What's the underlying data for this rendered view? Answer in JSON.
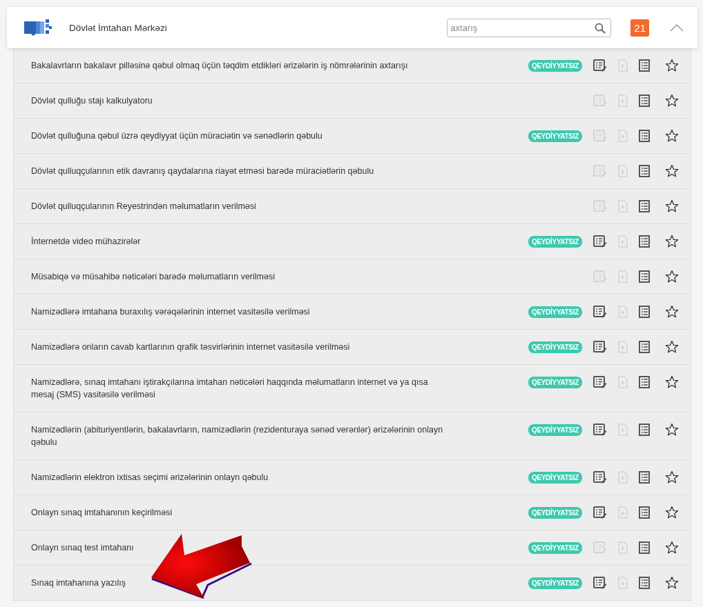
{
  "header": {
    "title": "Dövlət İmtahan Mərkəzi",
    "search": {
      "placeholder": "axtarış"
    },
    "count": "21",
    "expanded": true
  },
  "services": [
    {
      "title": "Bakalavrların bakalavr pilləsinə qəbul olmaq üçün təqdim etdikləri ərizələrin iş nömrələrinin axtarışı",
      "badge": "QEYDİYYATSIZ",
      "form_disabled": false,
      "video_disabled": true
    },
    {
      "title": "Dövlət qulluğu stajı kalkulyatoru",
      "form_disabled": true,
      "video_disabled": true
    },
    {
      "title": "Dövlət qulluğuna qəbul üzrə qeydiyyat üçün müraciətin və sənədlərin qəbulu",
      "badge": "QEYDİYYATSIZ",
      "form_disabled": true,
      "video_disabled": true
    },
    {
      "title": "Dövlət qulluqçularının etik davranış qaydalarına riayət etməsi barədə müraciətlərin qəbulu",
      "form_disabled": true,
      "video_disabled": true
    },
    {
      "title": "Dövlət qulluqçularının Reyestrindən məlumatların verilməsi",
      "form_disabled": true,
      "video_disabled": true
    },
    {
      "title": "İnternetdə video mühazirələr",
      "badge": "QEYDİYYATSIZ",
      "form_disabled": false,
      "video_disabled": true
    },
    {
      "title": "Müsabiqə və müsahibə nəticələri barədə məlumatların verilməsi",
      "form_disabled": true,
      "video_disabled": true
    },
    {
      "title": "Namizədlərə imtahana buraxılış vərəqələrinin internet vasitəsilə verilməsi",
      "badge": "QEYDİYYATSIZ",
      "form_disabled": false,
      "video_disabled": true
    },
    {
      "title": "Namizədlərə onların cavab kartlarının qrafik təsvirlərinin internet vasitəsilə verilməsi",
      "badge": "QEYDİYYATSIZ",
      "form_disabled": false,
      "video_disabled": true
    },
    {
      "title": "Namizədlərə, sınaq imtahanı iştirakçılarına imtahan nəticələri haqqında məlumatların internet və ya qısa mesaj (SMS) vasitəsilə verilməsi",
      "badge": "QEYDİYYATSIZ",
      "form_disabled": false,
      "video_disabled": true
    },
    {
      "title": "Namizədlərin (abituriyentlərin, bakalavrların, namizədlərin (rezidenturaya sənəd verənlər) ərizələrinin onlayn qəbulu",
      "badge": "QEYDİYYATSIZ",
      "form_disabled": false,
      "video_disabled": true
    },
    {
      "title": "Namizədlərin elektron ixtisas seçimi ərizələrinin onlayn qəbulu",
      "badge": "QEYDİYYATSIZ",
      "form_disabled": false,
      "video_disabled": true
    },
    {
      "title": "Onlayn sınaq imtahanının keçirilməsi",
      "badge": "QEYDİYYATSIZ",
      "form_disabled": false,
      "video_disabled": true
    },
    {
      "title": "Onlayn sınaq test imtahanı",
      "badge": "QEYDİYYATSIZ",
      "form_disabled": true,
      "video_disabled": true
    },
    {
      "title": "Sınaq imtahanına yazılış",
      "badge": "QEYDİYYATSIZ",
      "form_disabled": false,
      "video_disabled": true
    }
  ]
}
